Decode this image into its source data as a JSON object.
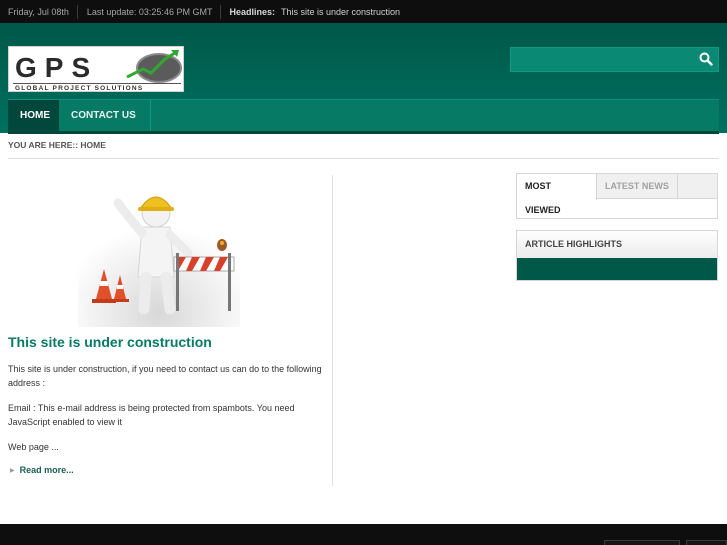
{
  "topbar": {
    "date": "Friday, Jul 08th",
    "last_update": "Last update: 03:25:46 PM GMT",
    "headlines_label": "Headlines:",
    "headline_text": "This site is under construction"
  },
  "logo": {
    "text": "GPS",
    "tagline": "GLOBAL PROJECT SOLUTIONS"
  },
  "search": {
    "value": "",
    "icon": "search-icon"
  },
  "nav": {
    "items": [
      {
        "label": "HOME",
        "active": true
      },
      {
        "label": "CONTACT US",
        "active": false
      }
    ]
  },
  "breadcrumb": "YOU ARE HERE:: HOME",
  "article": {
    "title": "This site is under construction",
    "paragraphs": [
      "This site is under construction, if you need to contact us can do to the following address :",
      "Email : This e-mail address is being protected from spambots. You need JavaScript enabled to view it",
      "Web page ..."
    ],
    "read_more": "Read more..."
  },
  "tabs_module": {
    "tabs": [
      "MOST VIEWED",
      "LATEST NEWS"
    ]
  },
  "highlights_module": {
    "title": "ARTICLE HIGHLIGHTS"
  },
  "colors": {
    "brand_green": "#077a66",
    "dark_green": "#005849",
    "topbar": "#0e0e0e"
  }
}
